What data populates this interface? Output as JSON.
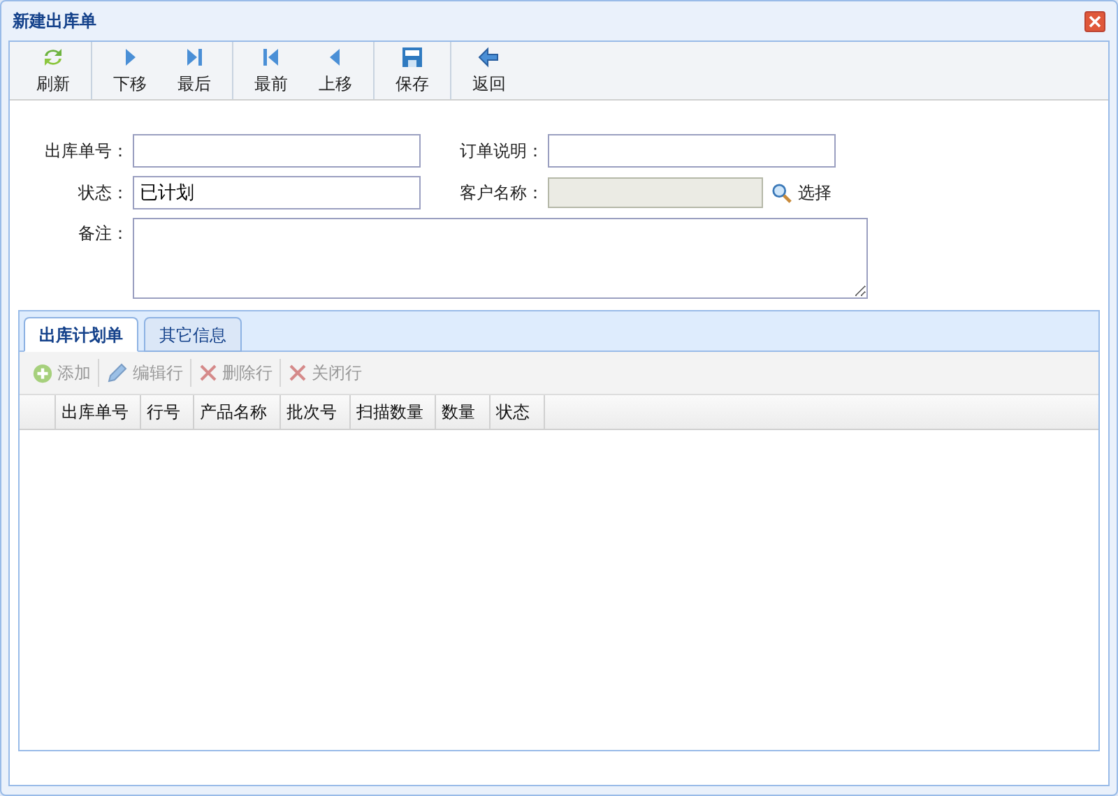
{
  "window": {
    "title": "新建出库单"
  },
  "toolbar": [
    {
      "label": "刷新"
    },
    {
      "label": "下移"
    },
    {
      "label": "最后"
    },
    {
      "label": "最前"
    },
    {
      "label": "上移"
    },
    {
      "label": "保存"
    },
    {
      "label": "返回"
    }
  ],
  "form": {
    "order_no": {
      "label": "出库单号："
    },
    "order_note": {
      "label": "订单说明："
    },
    "status": {
      "label": "状态：",
      "value": "已计划"
    },
    "customer": {
      "label": "客户名称：",
      "disabled": true,
      "select_label": "选择"
    },
    "remark": {
      "label": "备注："
    }
  },
  "tabs": [
    {
      "label": "出库计划单",
      "selected": true
    },
    {
      "label": "其它信息",
      "selected": false
    }
  ],
  "grid_toolbar": [
    {
      "label": "添加",
      "disabled": true
    },
    {
      "label": "编辑行",
      "disabled": true
    },
    {
      "label": "删除行",
      "disabled": true
    },
    {
      "label": "关闭行",
      "disabled": true
    }
  ],
  "table": {
    "columns": [
      "出库单号",
      "行号",
      "产品名称",
      "批次号",
      "扫描数量",
      "数量",
      "状态"
    ]
  }
}
